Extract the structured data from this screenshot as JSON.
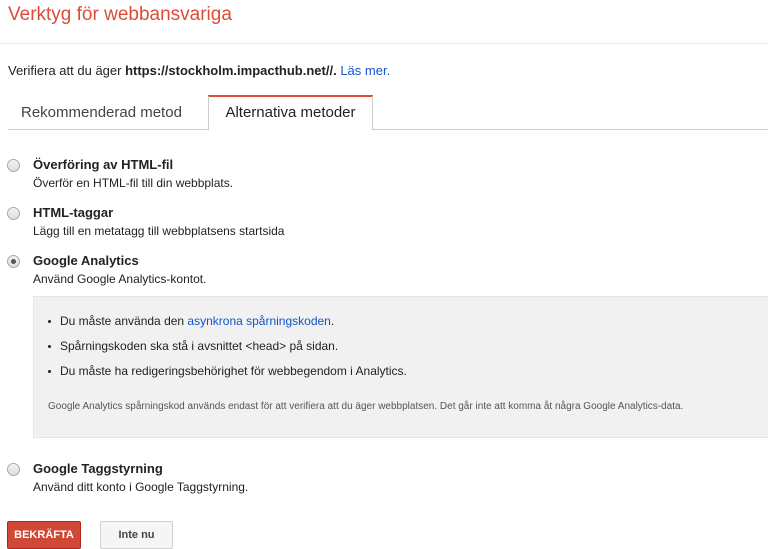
{
  "header": {
    "title": "Verktyg för webbansvariga"
  },
  "verify": {
    "prefix": "Verifiera att du äger ",
    "site": "https://stockholm.impacthub.net/",
    "suffix": "/. ",
    "learn_more": "Läs mer."
  },
  "tabs": [
    {
      "label": "Rekommenderad metod",
      "active": false
    },
    {
      "label": "Alternativa metoder",
      "active": true
    }
  ],
  "options": [
    {
      "title": "Överföring av HTML-fil",
      "description": "Överför en HTML-fil till din webbplats.",
      "selected": false
    },
    {
      "title": "HTML-taggar",
      "description": "Lägg till en metatagg till webbplatsens startsida",
      "selected": false
    },
    {
      "title": "Google Analytics",
      "description": "Använd Google Analytics-kontot.",
      "selected": true
    },
    {
      "title": "Google Taggstyrning",
      "description": "Använd ditt konto i Google Taggstyrning.",
      "selected": false
    }
  ],
  "analytics_info": {
    "bullet1_prefix": "Du måste använda den ",
    "bullet1_link": "asynkrona spårningskoden",
    "bullet1_suffix": ".",
    "bullet2": "Spårningskoden ska stå i avsnittet <head> på sidan.",
    "bullet3": "Du måste ha redigeringsbehörighet för webbegendom i Analytics.",
    "note": "Google Analytics spårningskod används endast för att verifiera att du äger webbplatsen. Det går inte att komma åt några Google Analytics-data."
  },
  "buttons": {
    "confirm": "BEKRÄFTA",
    "cancel": "Inte nu"
  },
  "colors": {
    "accent": "#dd4b39",
    "link": "#1155cc",
    "confirm_button": "#d14836"
  }
}
